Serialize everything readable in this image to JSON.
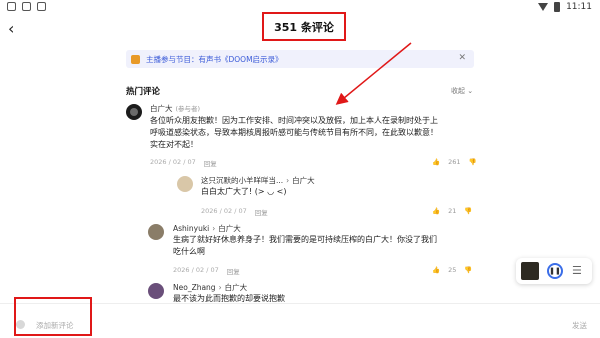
{
  "status_bar": {
    "time": "11:11"
  },
  "header": {
    "title": "351 条评论",
    "back_icon": "‹"
  },
  "banner": {
    "text": "主播参与节目：有声书《DOOM启示录》",
    "close": "✕"
  },
  "section": {
    "title": "热门评论",
    "collapse": "收起 ⌄"
  },
  "main_comment": {
    "author": "白广大",
    "author_tag": "(参与者)",
    "lines": [
      "各位听众朋友抱歉！因为工作安排、时间冲突以及放假，加上本人在录制时处于上",
      "呼吸道感染状态，导致本期核周报听感可能与传统节目有所不同，在此致以歉意！",
      "实在对不起！"
    ],
    "date": "2026 / 02 / 07",
    "reply_label": "回复",
    "likes": "261"
  },
  "replies": [
    {
      "author": "这只沉默的小羊咩咩当...",
      "to": "白广大",
      "text": "白白太广大了! (> ◡ <) ",
      "date": "2026 / 02 / 07",
      "reply_label": "回复",
      "likes": "21"
    },
    {
      "author": "Ashinyuki",
      "to": "白广大",
      "lines": [
        "生病了就好好休息养身子！我们需要的是可持续压榨的白广大！你没了我们",
        "吃什么啊"
      ],
      "date": "2026 / 02 / 07",
      "reply_label": "回复",
      "likes": "25"
    },
    {
      "author": "Neo_Zhang",
      "to": "白广大",
      "text": "最不该为此而抱歉的却要说抱歉"
    }
  ],
  "footer": {
    "placeholder": "添加新评论",
    "send": "发送"
  },
  "colors": {
    "accent": "#3b5bd8",
    "annotation_red": "#e01818"
  }
}
